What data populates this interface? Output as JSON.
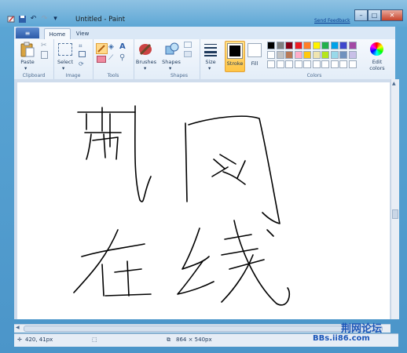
{
  "window": {
    "title": "Untitled - Paint",
    "send_feedback": "Send Feedback",
    "controls": {
      "minimize": "–",
      "maximize": "□",
      "close": "✕"
    }
  },
  "tabs": {
    "menu_icon": "≡",
    "home": "Home",
    "view": "View"
  },
  "ribbon": {
    "clipboard": {
      "paste": "Paste",
      "group": "Clipboard"
    },
    "image": {
      "select": "Select",
      "group": "Image"
    },
    "tools": {
      "group": "Tools",
      "text_tool": "A"
    },
    "brushes": {
      "label": "Brushes"
    },
    "shapes": {
      "label": "Shapes",
      "group": "Shapes"
    },
    "size": {
      "label": "Size"
    },
    "stroke": {
      "label": "Stroke"
    },
    "fill": {
      "label": "Fill"
    },
    "colors": {
      "group": "Colors",
      "edit_colors_line1": "Edit",
      "edit_colors_line2": "colors",
      "palette_row1": [
        "#000000",
        "#7f7f7f",
        "#880015",
        "#ed1c24",
        "#ff7f27",
        "#fff200",
        "#22b14c",
        "#00a2e8",
        "#3f48cc",
        "#a349a4"
      ],
      "palette_row2": [
        "#ffffff",
        "#c3c3c3",
        "#b97a57",
        "#ffaec9",
        "#ffc90e",
        "#efe4b0",
        "#b5e61d",
        "#99d9ea",
        "#7092be",
        "#c8bfe7"
      ]
    }
  },
  "status": {
    "cursor_pos": "420, 41px",
    "image_size": "864 × 540px"
  },
  "watermark": {
    "title": "荆网论坛",
    "url": "BBs.ii86.com"
  }
}
